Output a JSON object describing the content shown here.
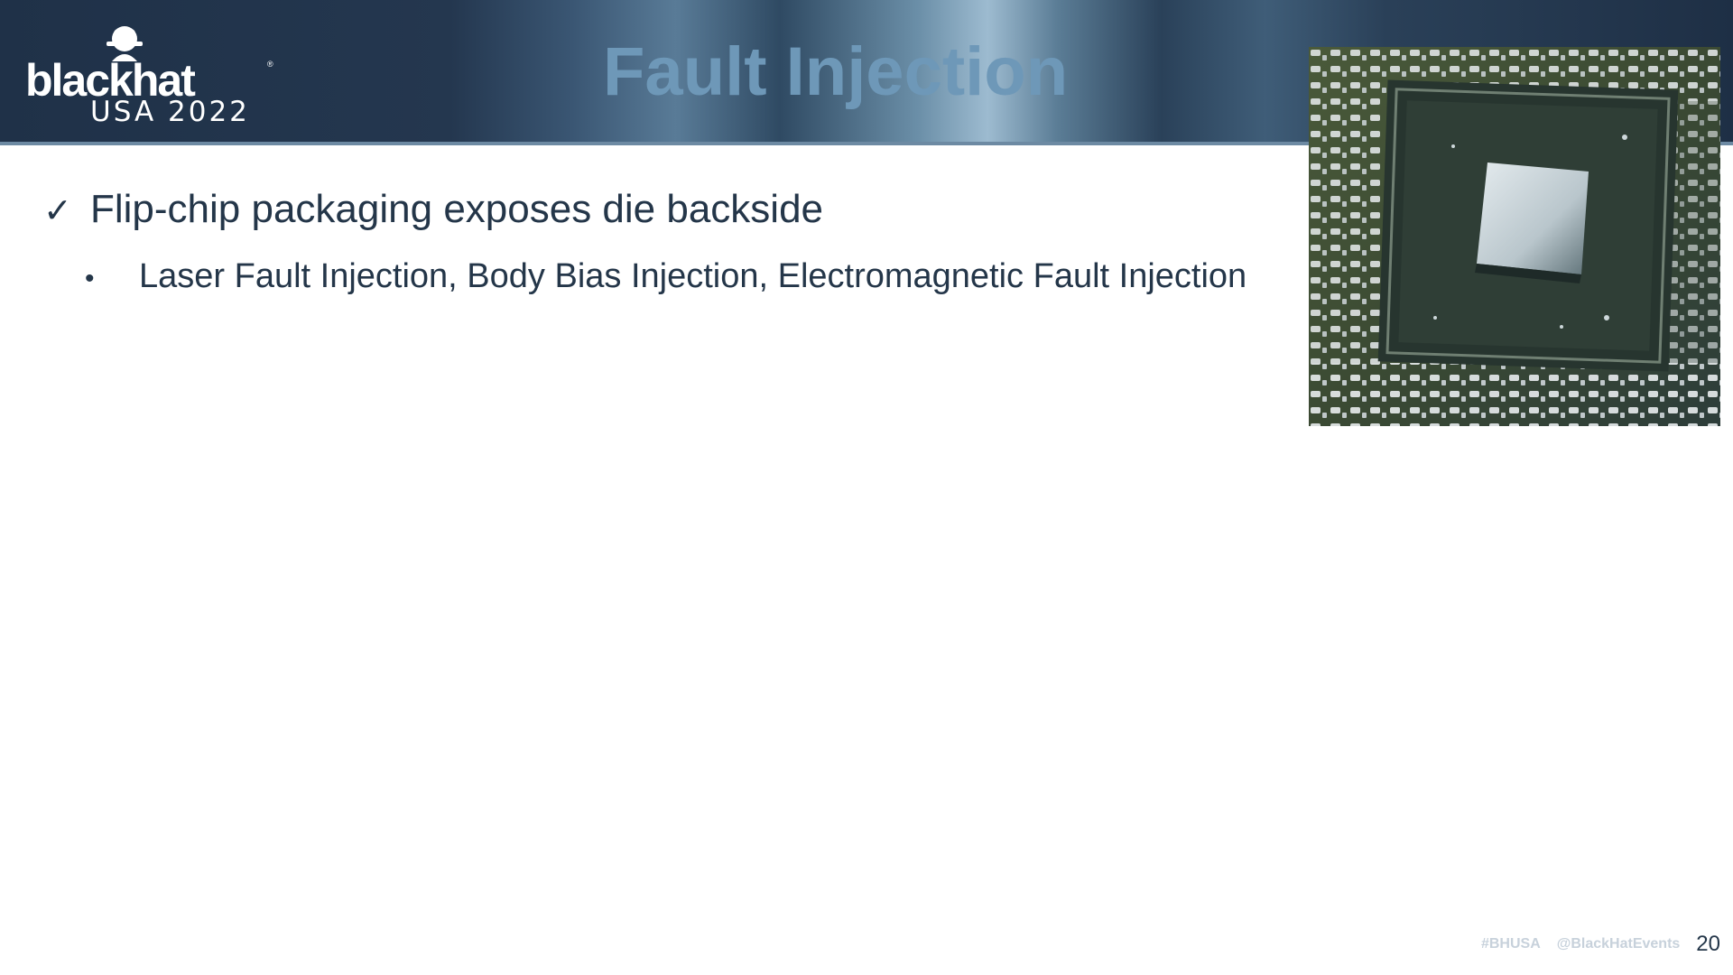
{
  "logo": {
    "wordmark": "blackhat",
    "registered": "®",
    "event": "USA 2022"
  },
  "slide": {
    "title": "Fault Injection",
    "bullets": [
      {
        "marker": "✓",
        "text": "Flip-chip packaging exposes die backside",
        "sub_bullets": [
          {
            "marker": "•",
            "text": "Laser Fault Injection, Body Bias Injection, Electromagnetic Fault Injection"
          }
        ]
      }
    ],
    "image": {
      "subject": "flip-chip-package-photo"
    }
  },
  "footer": {
    "hashtag": "#BHUSA",
    "handle": "@BlackHatEvents",
    "page_number": "20"
  },
  "colors": {
    "header_bg": "#24374f",
    "title": "#6e98b8",
    "body_text": "#243649",
    "footer_tag": "#c7d1db"
  }
}
